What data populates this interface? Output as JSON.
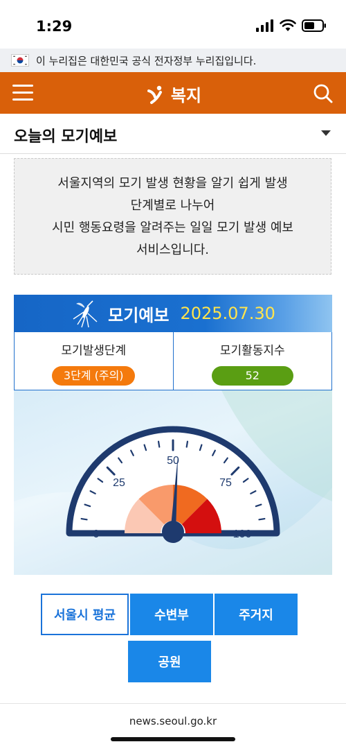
{
  "status": {
    "time": "1:29"
  },
  "gov_banner": {
    "text": "이 누리집은 대한민국 공식 전자정부 누리집입니다."
  },
  "header": {
    "title": "복지",
    "accent": "#d9600a"
  },
  "section": {
    "title": "오늘의 모기예보"
  },
  "description": {
    "lines": [
      "서울지역의 모기 발생 현황을 알기 쉽게 발생",
      "단계별로 나누어",
      "시민 행동요령을 알려주는 일일 모기 발생 예보",
      "서비스입니다."
    ]
  },
  "forecast": {
    "title": "모기예보",
    "date": "2025.07.30",
    "stage_label": "모기발생단계",
    "stage_value": "3단계 (주의)",
    "index_label": "모기활동지수",
    "index_value": "52"
  },
  "gauge": {
    "value": 52,
    "min": 0,
    "max": 100,
    "tick_labels": [
      "0",
      "25",
      "50",
      "75",
      "100"
    ],
    "zone_colors": [
      "#fbc8b4",
      "#f99a6b",
      "#f06a20",
      "#d40f0f"
    ]
  },
  "buttons": {
    "seoul_avg": "서울시 평균",
    "waterside": "수변부",
    "residential": "주거지",
    "park": "공원"
  },
  "browser": {
    "url": "news.seoul.go.kr"
  }
}
